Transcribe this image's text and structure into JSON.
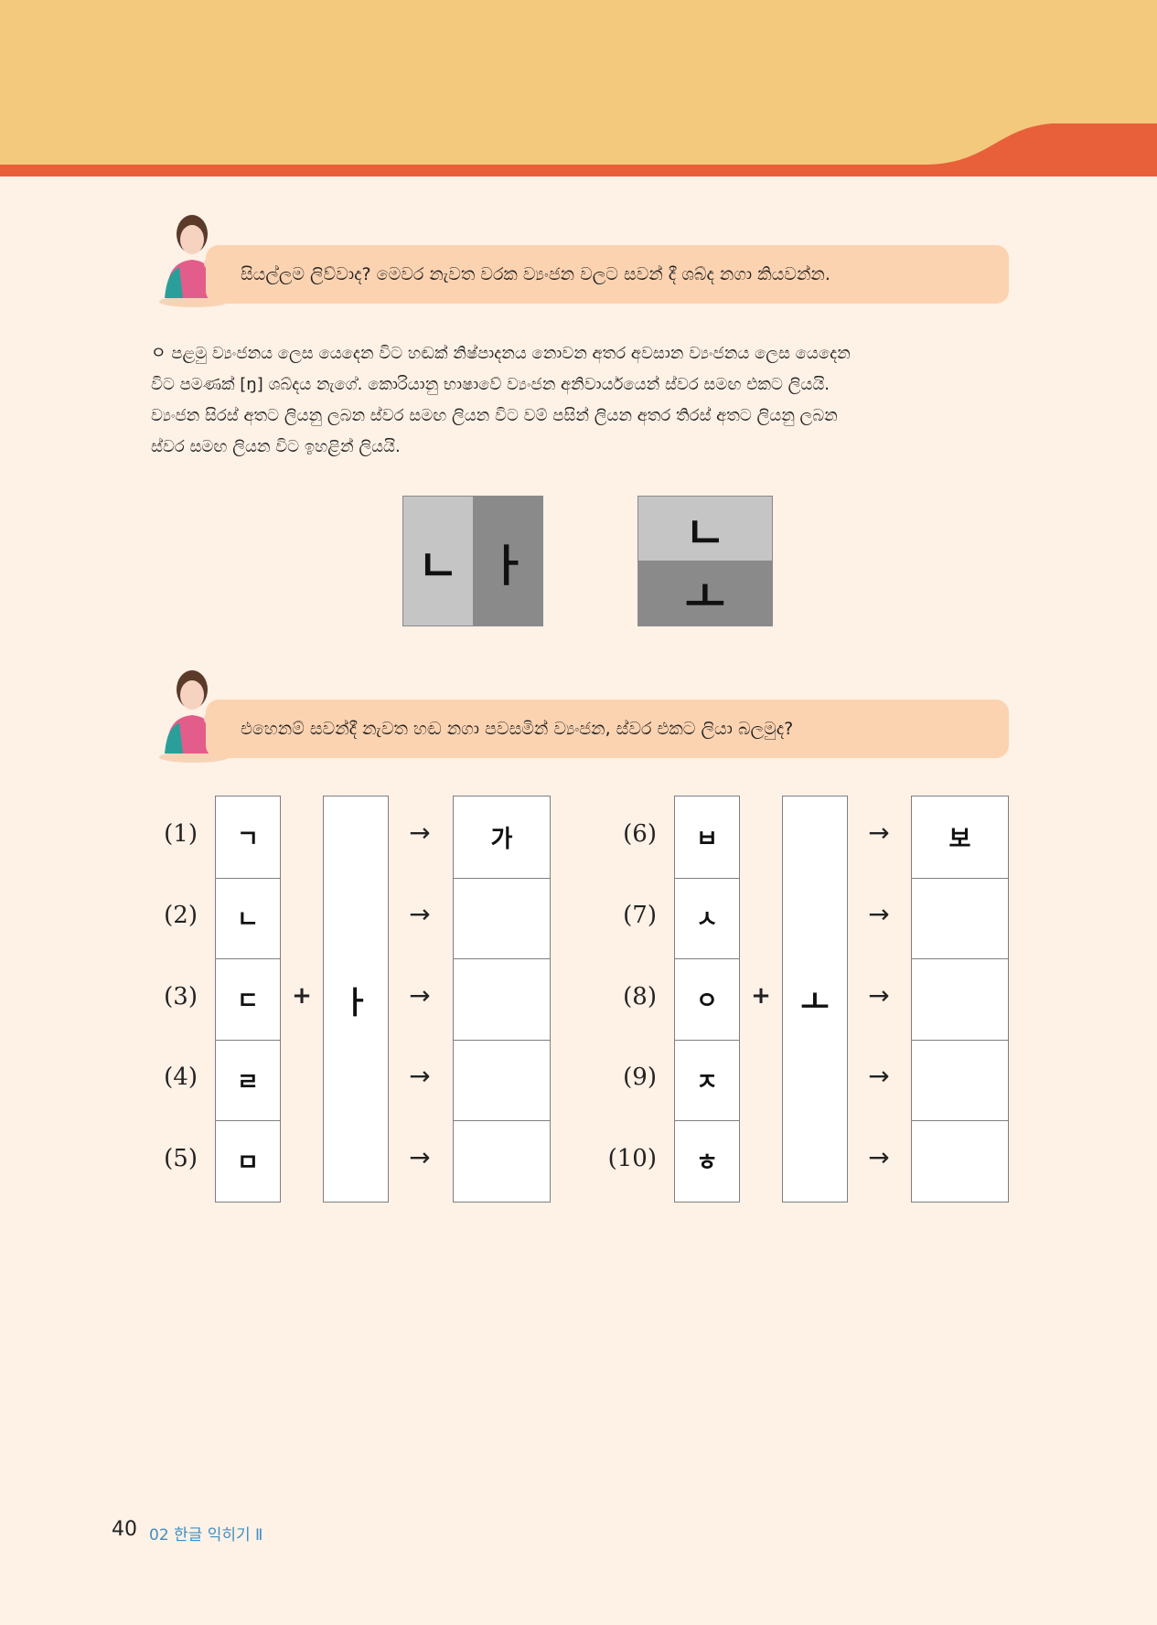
{
  "colors": {
    "header_top": "#f3c97e",
    "header_stripe": "#e8603a",
    "page_bg": "#fef1e6",
    "speech_bg": "#fcd3b1",
    "footer_chapter": "#3f8fc4"
  },
  "speech1": {
    "text": "සියල්ලම ලිව්වාද? මෙවර නැවත වරක ව්‍යංජන වලට සවන් දී ශබ්ද නගා කියවන්න."
  },
  "note": {
    "line1": "ㅇ පළමු ව්‍යංජනය ලෙස යෙදෙන විට හඬක් නිෂ්පාදනය නොවන අතර අවසාන ව්‍යංජනය ලෙස යෙදෙන",
    "line2": "විට පමණක් [ŋ] ශබ්දය නැගේ. කොරියානු භාෂාවේ ව්‍යංජන අනිවාර්යයෙන් ස්වර සමඟ එකට ලියයි.",
    "line3": "ව්‍යංජන සිරස් අතට ලියනු ලබන ස්වර සමඟ ලියන විට වම් පසින් ලියන අතර තිරස් අතට ලියනු ලබන",
    "line4": "ස්වර සමඟ ලියන විට ඉහළින් ලියයි."
  },
  "diagram_left": {
    "consonant": "ㄴ",
    "vowel": "ㅏ"
  },
  "diagram_right": {
    "consonant": "ㄴ",
    "vowel": "ㅗ"
  },
  "speech2": {
    "text": "එහෙනම් සවන්දී නැවත හඬ නගා පවසමින් ව්‍යංජන, ස්වර එකට ලියා බලමුද?"
  },
  "exercise_left": {
    "vowel": "ㅏ",
    "plus": "+",
    "arrow": "→",
    "rows": [
      {
        "label": "(1)",
        "consonant": "ㄱ",
        "answer": "가"
      },
      {
        "label": "(2)",
        "consonant": "ㄴ",
        "answer": ""
      },
      {
        "label": "(3)",
        "consonant": "ㄷ",
        "answer": ""
      },
      {
        "label": "(4)",
        "consonant": "ㄹ",
        "answer": ""
      },
      {
        "label": "(5)",
        "consonant": "ㅁ",
        "answer": ""
      }
    ]
  },
  "exercise_right": {
    "vowel": "ㅗ",
    "plus": "+",
    "arrow": "→",
    "rows": [
      {
        "label": "(6)",
        "consonant": "ㅂ",
        "answer": "보"
      },
      {
        "label": "(7)",
        "consonant": "ㅅ",
        "answer": ""
      },
      {
        "label": "(8)",
        "consonant": "ㅇ",
        "answer": ""
      },
      {
        "label": "(9)",
        "consonant": "ㅈ",
        "answer": ""
      },
      {
        "label": "(10)",
        "consonant": "ㅎ",
        "answer": ""
      }
    ]
  },
  "footer": {
    "page_number": "40",
    "chapter": "02 한글 익히기 Ⅱ"
  }
}
